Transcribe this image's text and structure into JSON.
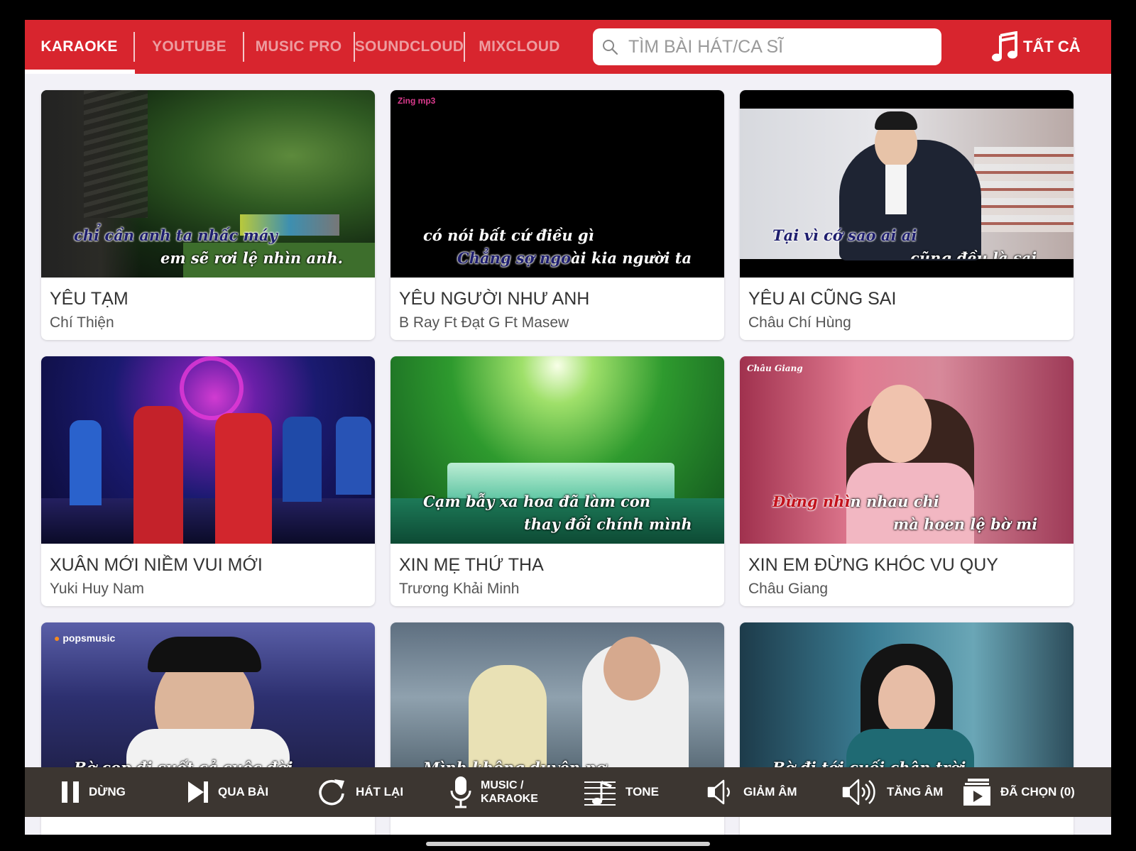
{
  "tabs": [
    {
      "label": "KARAOKE",
      "active": true
    },
    {
      "label": "YOUTUBE",
      "active": false
    },
    {
      "label": "MUSIC PRO",
      "active": false
    },
    {
      "label": "SOUNDCLOUD",
      "active": false
    },
    {
      "label": "MIXCLOUD",
      "active": false
    }
  ],
  "search": {
    "placeholder": "TÌM BÀI HÁT/CA SĨ",
    "value": ""
  },
  "all_button": {
    "label": "TẤT CẢ",
    "icon": "music-note-icon"
  },
  "songs": [
    {
      "title": "YÊU TẠM",
      "artist": "Chí Thiện",
      "lyric1_hl": "chỉ cần anh ta nhấc máy",
      "lyric1_rest": "",
      "lyric2": "em sẽ rơi lệ nhìn anh."
    },
    {
      "title": "YÊU NGƯỜI NHƯ ANH",
      "artist": "B Ray Ft Đạt G Ft Masew",
      "lyric1": "có nói bất cứ điều gì",
      "lyric2_hl": "Chẳng sợ ngo",
      "lyric2_rest": "ài kia người ta",
      "watermark": "Zing mp3"
    },
    {
      "title": "YÊU AI CŨNG SAI",
      "artist": "Châu Chí Hùng",
      "lyric1_hl": "Tại vì cớ sao ai ai",
      "lyric2": "cũng đều là sai"
    },
    {
      "title": "XUÂN MỚI NIỀM VUI MỚI",
      "artist": "Yuki Huy Nam"
    },
    {
      "title": "XIN MẸ THỨ THA",
      "artist": "Trương Khải Minh",
      "lyric1": "Cạm bẫy xa hoa đã làm con",
      "lyric2": "thay đổi chính mình"
    },
    {
      "title": "XIN EM ĐỪNG KHÓC VU QUY",
      "artist": "Châu Giang",
      "lyric1_hl": "Đừng nhì",
      "lyric1_rest": "n nhau chi",
      "lyric2": "mà hoen lệ bờ mi",
      "watermark": "Châu Giang"
    },
    {
      "title": "",
      "artist": "",
      "watermark": "popsmusic",
      "lyric1": "Bờ cọp đi suốt cả cuộc đời"
    },
    {
      "title": "",
      "artist": "",
      "lyric1": "Mình không duyên nợ"
    },
    {
      "title": "",
      "artist": "",
      "lyric1": "Bờ đi tới cuối chân trời"
    }
  ],
  "controls": [
    {
      "label": "DỪNG",
      "icon": "pause-icon"
    },
    {
      "label": "QUA BÀI",
      "icon": "skip-next-icon"
    },
    {
      "label": "HÁT LẠI",
      "icon": "replay-icon"
    },
    {
      "label_line1": "MUSIC /",
      "label_line2": "KARAOKE",
      "icon": "microphone-icon"
    },
    {
      "label": "TONE",
      "icon": "music-tone-icon"
    },
    {
      "label": "GIẢM ÂM",
      "icon": "volume-down-icon"
    },
    {
      "label": "TĂNG ÂM",
      "icon": "volume-up-icon"
    },
    {
      "label": "ĐÃ CHỌN (0)",
      "icon": "playlist-play-icon"
    }
  ],
  "colors": {
    "accent": "#d8252e",
    "background": "#f2f1f7",
    "bottom_bar": "#3c3631"
  }
}
